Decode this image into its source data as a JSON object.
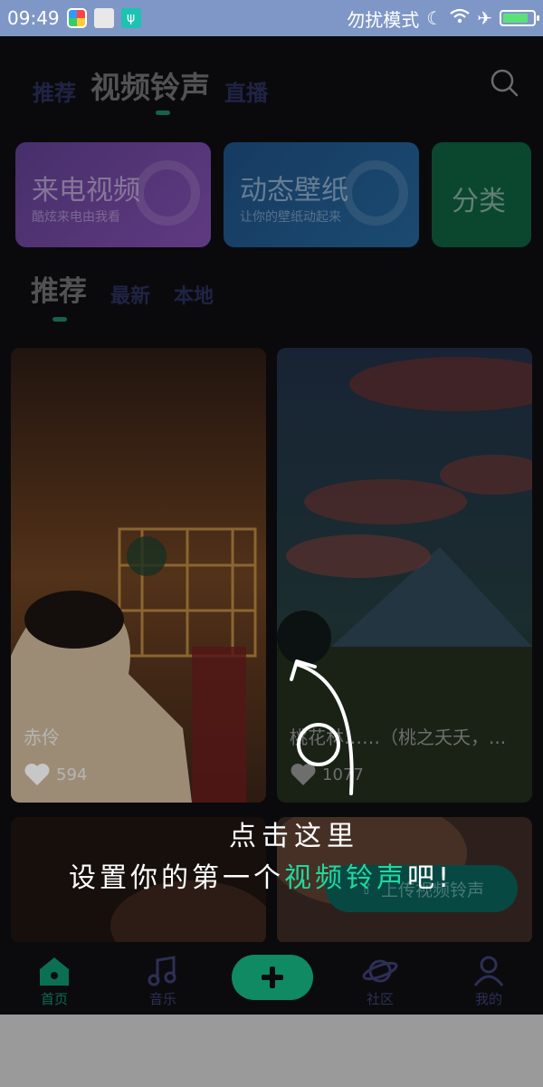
{
  "status_bar": {
    "time": "09:49",
    "dnd_label": "勿扰模式",
    "battery_level": 0.85
  },
  "top_tabs": [
    {
      "label": "推荐"
    },
    {
      "label": "视频铃声"
    },
    {
      "label": "直播"
    }
  ],
  "cards": [
    {
      "title": "来电视频",
      "subtitle": "酷炫来电由我看"
    },
    {
      "title": "动态壁纸",
      "subtitle": "让你的壁纸动起来"
    },
    {
      "title": "分类"
    }
  ],
  "sub_tabs": [
    {
      "label": "推荐"
    },
    {
      "label": "最新"
    },
    {
      "label": "本地"
    }
  ],
  "videos": [
    {
      "title": "赤伶",
      "likes": "594"
    },
    {
      "title": "桃花林……（桃之夭夭，...",
      "likes": "1077"
    }
  ],
  "upload_button": "上传视频铃声",
  "hint": {
    "line1": "点击这里",
    "line2_prefix": "设置你的第一个",
    "line2_highlight": "视频铃声",
    "line2_suffix": "吧!"
  },
  "bottom_nav": [
    {
      "label": "首页",
      "icon": "home-icon"
    },
    {
      "label": "音乐",
      "icon": "music-icon"
    },
    {
      "label": "社区",
      "icon": "planet-icon"
    },
    {
      "label": "我的",
      "icon": "user-icon"
    }
  ],
  "colors": {
    "accent": "#0f8a63",
    "highlight": "#1fd99f",
    "statusbar": "#7f97c6"
  }
}
